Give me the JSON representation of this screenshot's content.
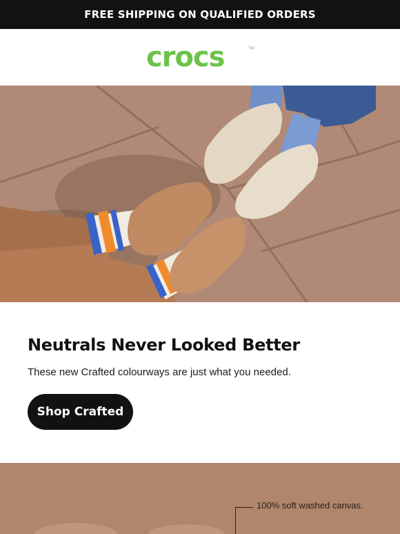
{
  "topbar": {
    "text": "FREE SHIPPING ON QUALIFIED ORDERS"
  },
  "brand": {
    "logo_text": "crocs",
    "trademark": "TM",
    "logo_color": "#6cc24a"
  },
  "hero": {
    "image": "photo-two-pairs-crafted-clogs-on-stone-tiles"
  },
  "promo": {
    "headline": "Neutrals Never Looked Better",
    "subtext": "These new Crafted colourways are just what you needed.",
    "cta_label": "Shop Crafted"
  },
  "product_section": {
    "callout": "100% soft washed canvas.",
    "background_color": "#b0866c"
  },
  "colors": {
    "dark": "#141114",
    "white": "#ffffff"
  }
}
